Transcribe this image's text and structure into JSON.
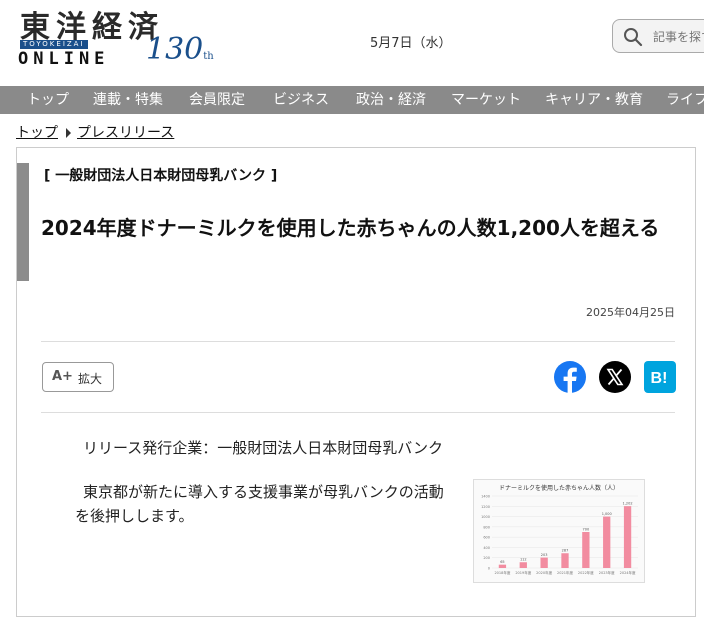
{
  "header": {
    "logo_jp": "東洋経済",
    "logo_roman": "TOYOKEIZAI",
    "logo_online": "ONLINE",
    "logo_anniv": "130",
    "logo_anniv_suffix": "th",
    "date": "5月7日（水）",
    "search_placeholder": "記事を探す"
  },
  "nav": {
    "items": [
      "トップ",
      "連載・特集",
      "会員限定",
      "ビジネス",
      "政治・経済",
      "マーケット",
      "キャリア・教育",
      "ライフ"
    ]
  },
  "breadcrumb": {
    "home": "トップ",
    "current": "プレスリリース"
  },
  "article": {
    "category": "[ 一般財団法人日本財団母乳バンク ]",
    "title": "2024年度ドナーミルクを使用した赤ちゃんの人数1,200人を超える",
    "date": "2025年04月25日",
    "zoom_icon": "A+",
    "zoom_label": "拡大",
    "issuer": "リリース発行企業：一般財団法人日本財団母乳バンク",
    "lead": "東京都が新たに導入する支援事業が母乳バンクの活動を後押しします。"
  },
  "share_icons": [
    "facebook-icon",
    "x-icon",
    "hatena-bookmark-icon"
  ],
  "colors": {
    "nav_bg": "#8a8a8a",
    "brand_blue": "#1a4f8b",
    "facebook": "#1877f2",
    "hatena": "#00a4de",
    "bar_pink": "#f28ca0"
  },
  "thumbnail_chart": {
    "title": "ドナーミルクを使用した赤ちゃん人数（人）",
    "categories": [
      "2018年度",
      "2019年度",
      "2020年度",
      "2021年度",
      "2022年度",
      "2023年度",
      "2024年度"
    ],
    "values": [
      65,
      112,
      203,
      287,
      700,
      1000,
      1202
    ]
  }
}
